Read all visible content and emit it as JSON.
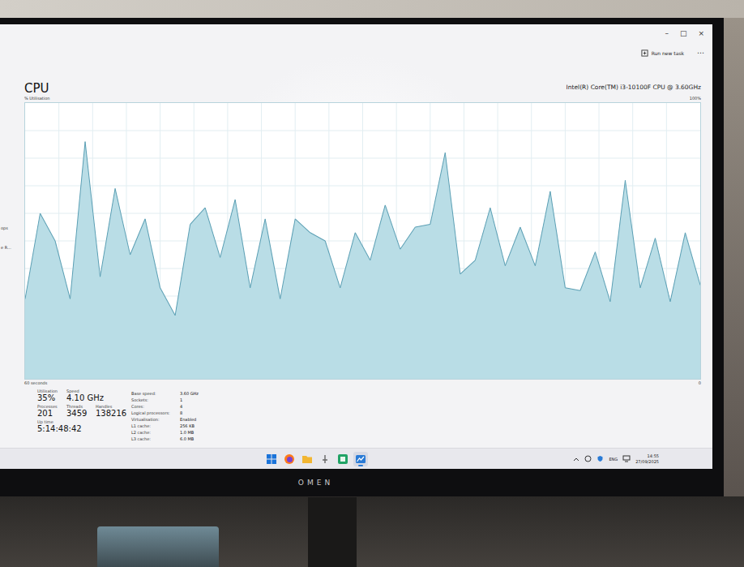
{
  "window": {
    "controls": [
      "–",
      "□",
      "×"
    ]
  },
  "toolbar": {
    "run_new_task": "Run new task",
    "more": "⋯"
  },
  "sidebar": {
    "items": [
      "ops",
      "e R..."
    ]
  },
  "page": {
    "title": "CPU",
    "subtitle": "% Utilisation",
    "processor": "Intel(R) Core(TM) i3-10100F CPU @ 3.60GHz"
  },
  "chart": {
    "max_label": "100%",
    "x_start_label": "60 seconds",
    "x_end_label": "0",
    "series": [
      {
        "name": "Utilisation",
        "values": [
          29,
          60,
          50,
          29,
          86,
          37,
          69,
          45,
          58,
          33,
          23,
          56,
          62,
          44,
          65,
          33,
          58,
          29,
          58,
          53,
          50,
          33,
          53,
          43,
          63,
          47,
          55,
          56,
          82,
          38,
          43,
          62,
          41,
          55,
          41,
          68,
          33,
          32,
          46,
          28,
          72,
          33,
          51,
          28,
          53,
          34
        ]
      }
    ]
  },
  "stats": {
    "rows": [
      [
        {
          "label": "Utilisation",
          "value": "35%"
        },
        {
          "label": "Speed",
          "value": "4.10 GHz"
        }
      ],
      [
        {
          "label": "Processes",
          "value": "201"
        },
        {
          "label": "Threads",
          "value": "3459"
        },
        {
          "label": "Handles",
          "value": "138216"
        }
      ],
      [
        {
          "label": "Up time",
          "value": "5:14:48:42"
        }
      ]
    ]
  },
  "details": [
    {
      "label": "Base speed:",
      "value": "3.60 GHz"
    },
    {
      "label": "Sockets:",
      "value": "1"
    },
    {
      "label": "Cores:",
      "value": "4"
    },
    {
      "label": "Logical processors:",
      "value": "8"
    },
    {
      "label": "Virtualisation:",
      "value": "Enabled"
    },
    {
      "label": "L1 cache:",
      "value": "256 KB"
    },
    {
      "label": "L2 cache:",
      "value": "1.0 MB"
    },
    {
      "label": "L3 cache:",
      "value": "6.0 MB"
    }
  ],
  "taskbar": {
    "apps": [
      {
        "kind": "start",
        "selected": false
      },
      {
        "kind": "browser",
        "selected": false
      },
      {
        "kind": "folder",
        "selected": false
      },
      {
        "kind": "pin",
        "selected": false
      },
      {
        "kind": "editor",
        "selected": false
      },
      {
        "kind": "taskmanager",
        "selected": true
      }
    ],
    "language": "ENG",
    "time": "14:55",
    "date": "27/09/2025"
  },
  "monitor": {
    "brand": "OMEN"
  }
}
